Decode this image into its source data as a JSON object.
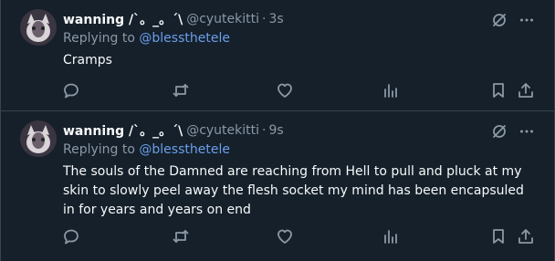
{
  "tweets": [
    {
      "display_name": "wanning /`。_。´\\",
      "handle": "@cyutekitti",
      "separator": "·",
      "time": "3s",
      "replying_prefix": "Replying to ",
      "replying_to": "@blessthetele",
      "text": "Cramps"
    },
    {
      "display_name": "wanning /`。_。´\\",
      "handle": "@cyutekitti",
      "separator": "·",
      "time": "9s",
      "replying_prefix": "Replying to ",
      "replying_to": "@blessthetele",
      "text": "The souls of the Damned are reaching from Hell to pull and pluck at my skin to slowly peel away the flesh socket my mind has been encapsuled in for years and years on end"
    }
  ],
  "icons": {
    "grok": "grok-icon",
    "more": "more-icon",
    "reply": "reply-icon",
    "retweet": "retweet-icon",
    "like": "heart-icon",
    "views": "views-icon",
    "bookmark": "bookmark-icon",
    "share": "share-icon"
  },
  "colors": {
    "background": "#15202b",
    "border": "#38444d",
    "text": "#f7f9f9",
    "muted": "#8b98a5",
    "mention": "#6b9ee9"
  }
}
